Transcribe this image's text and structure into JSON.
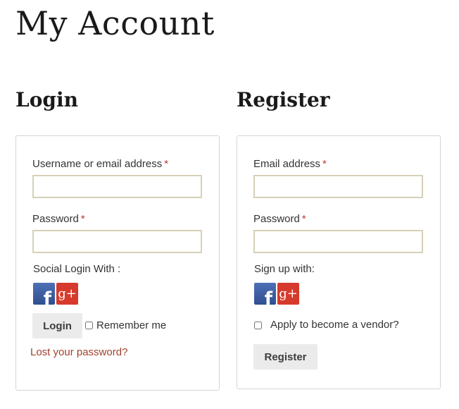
{
  "page": {
    "title": "My Account"
  },
  "login": {
    "heading": "Login",
    "username_label": "Username or email address",
    "username_value": "",
    "password_label": "Password",
    "password_value": "",
    "required_mark": "*",
    "social_label": "Social Login With :",
    "submit_label": "Login",
    "remember_label": "Remember me",
    "remember_checked": false,
    "lost_password_link": "Lost your password?"
  },
  "register": {
    "heading": "Register",
    "email_label": "Email address",
    "email_value": "",
    "password_label": "Password",
    "password_value": "",
    "required_mark": "*",
    "social_label": "Sign up with:",
    "vendor_label": "Apply to become a vendor?",
    "vendor_checked": false,
    "submit_label": "Register"
  },
  "social": {
    "facebook_glyph": "f",
    "google_glyph": "g+",
    "facebook_color": "#3b5998",
    "google_color": "#d63a2c"
  },
  "colors": {
    "required": "#c0392b",
    "link": "#a0422c",
    "field_border": "#d6d1b8"
  }
}
